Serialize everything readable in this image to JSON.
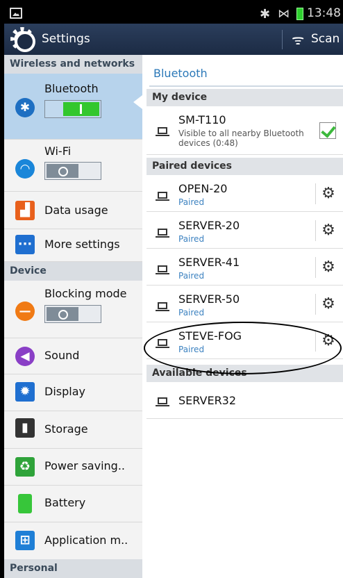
{
  "status_bar": {
    "time": "13:48",
    "bluetooth_icon": "bluetooth-icon",
    "mute_icon": "mute-icon",
    "battery_icon": "battery-icon"
  },
  "action_bar": {
    "title": "Settings",
    "scan_label": "Scan"
  },
  "left_panel": {
    "sections": {
      "wireless": "Wireless and networks",
      "device": "Device",
      "personal": "Personal"
    },
    "items": [
      {
        "label": "Bluetooth",
        "icon": "bluetooth-icon",
        "toggle": "on"
      },
      {
        "label": "Wi-Fi",
        "icon": "wifi-icon",
        "toggle": "off"
      },
      {
        "label": "Data usage",
        "icon": "data-usage-icon"
      },
      {
        "label": "More settings",
        "icon": "more-settings-icon"
      },
      {
        "label": "Blocking mode",
        "icon": "blocking-mode-icon",
        "toggle": "off"
      },
      {
        "label": "Sound",
        "icon": "sound-icon"
      },
      {
        "label": "Display",
        "icon": "display-icon"
      },
      {
        "label": "Storage",
        "icon": "storage-icon"
      },
      {
        "label": "Power saving..",
        "icon": "power-saving-icon"
      },
      {
        "label": "Battery",
        "icon": "battery-icon"
      },
      {
        "label": "Application m..",
        "icon": "application-manager-icon"
      }
    ]
  },
  "right_panel": {
    "title": "Bluetooth",
    "my_device_header": "My device",
    "my_device": {
      "name": "SM-T110",
      "visibility": "Visible to all nearby Bluetooth devices (0:48)",
      "checked": true
    },
    "paired_header": "Paired devices",
    "paired": [
      {
        "name": "OPEN-20",
        "status": "Paired"
      },
      {
        "name": "SERVER-20",
        "status": "Paired"
      },
      {
        "name": "SERVER-41",
        "status": "Paired"
      },
      {
        "name": "SERVER-50",
        "status": "Paired"
      },
      {
        "name": "STEVE-FOG",
        "status": "Paired"
      }
    ],
    "available_header": "Available devices",
    "available": [
      {
        "name": "SERVER32"
      }
    ]
  },
  "colors": {
    "accent_blue": "#2b78b8",
    "action_bar": "#1c2b44",
    "toggle_on": "#33c72d"
  }
}
